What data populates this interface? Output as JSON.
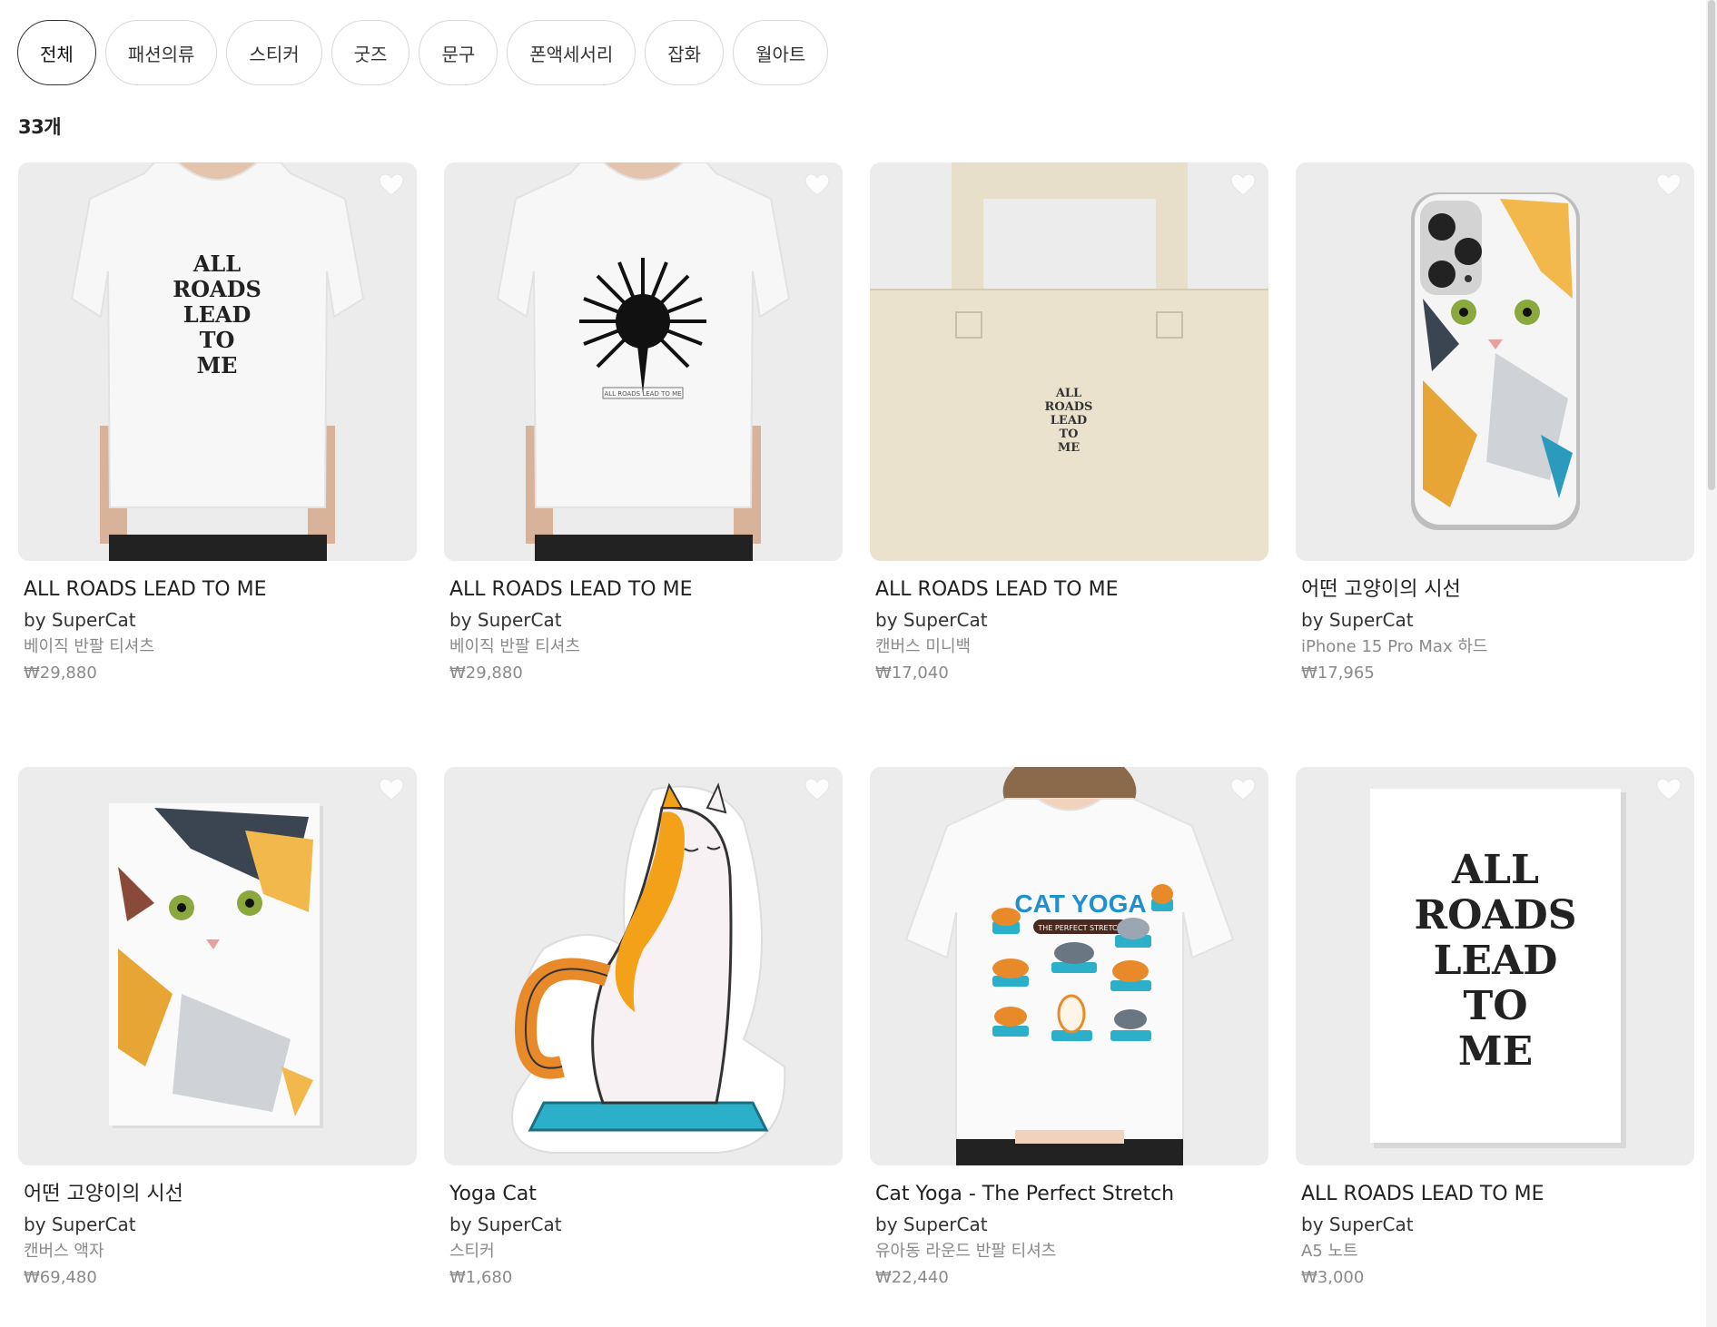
{
  "filters": {
    "categories": [
      {
        "label": "전체",
        "active": true
      },
      {
        "label": "패션의류",
        "active": false
      },
      {
        "label": "스티커",
        "active": false
      },
      {
        "label": "굿즈",
        "active": false
      },
      {
        "label": "문구",
        "active": false
      },
      {
        "label": "폰액세서리",
        "active": false
      },
      {
        "label": "잡화",
        "active": false
      },
      {
        "label": "월아트",
        "active": false
      }
    ]
  },
  "results": {
    "count_label": "33개"
  },
  "products": [
    {
      "title": "ALL ROADS LEAD TO ME",
      "seller": "by SuperCat",
      "product_type": "베이직 반팔 티셔츠",
      "price": "₩29,880",
      "image": "tshirt-all-roads"
    },
    {
      "title": "ALL ROADS LEAD TO ME",
      "seller": "by SuperCat",
      "product_type": "베이직 반팔 티셔츠",
      "price": "₩29,880",
      "image": "tshirt-sunburst"
    },
    {
      "title": "ALL ROADS LEAD TO ME",
      "seller": "by SuperCat",
      "product_type": "캔버스 미니백",
      "price": "₩17,040",
      "image": "tote-bag"
    },
    {
      "title": "어떤 고양이의 시선",
      "seller": "by SuperCat",
      "product_type": "iPhone 15 Pro Max 하드",
      "price": "₩17,965",
      "image": "phone-case-cat"
    },
    {
      "title": "어떤 고양이의 시선",
      "seller": "by SuperCat",
      "product_type": "캔버스 액자",
      "price": "₩69,480",
      "image": "canvas-cat"
    },
    {
      "title": "Yoga Cat",
      "seller": "by SuperCat",
      "product_type": "스티커",
      "price": "₩1,680",
      "image": "sticker-yoga-cat"
    },
    {
      "title": "Cat Yoga - The Perfect Stretch",
      "seller": "by SuperCat",
      "product_type": "유아동 라운드 반팔 티셔츠",
      "price": "₩22,440",
      "image": "kids-tshirt-cat-yoga"
    },
    {
      "title": "ALL ROADS LEAD TO ME",
      "seller": "by SuperCat",
      "product_type": "A5 노트",
      "price": "₩3,000",
      "image": "notebook-all-roads"
    }
  ],
  "artwork_text": {
    "all_roads": [
      "ALL",
      "ROADS",
      "LEAD",
      "TO",
      "ME"
    ],
    "cat_yoga": "CAT YOGA",
    "perfect_stretch": "THE PERFECT STRETCH",
    "small_caption": "ALL ROADS LEAD TO ME"
  },
  "icons": {
    "heart": "heart-icon"
  },
  "colors": {
    "card_bg": "#ededed",
    "heart": "#ffffff",
    "price": "#8a8a8a"
  }
}
